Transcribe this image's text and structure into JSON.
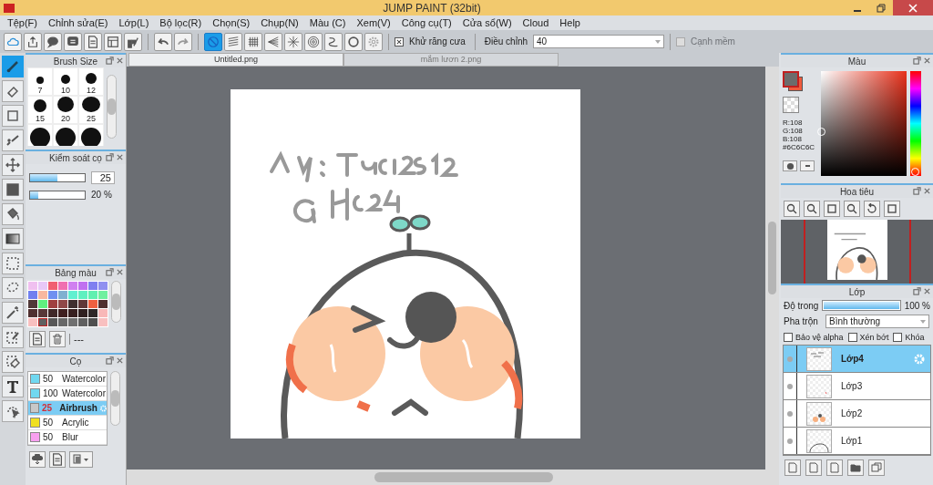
{
  "window": {
    "title": "JUMP PAINT (32bit)"
  },
  "menu": [
    "Tệp(F)",
    "Chỉnh sửa(E)",
    "Lớp(L)",
    "Bộ lọc(R)",
    "Chọn(S)",
    "Chụp(N)",
    "Màu (C)",
    "Xem(V)",
    "Công cụ(T)",
    "Cửa sổ(W)",
    "Cloud",
    "Help"
  ],
  "toolbar": {
    "groups": [
      [
        {
          "kind": "cloud",
          "selected": false
        },
        {
          "kind": "share",
          "selected": false
        },
        {
          "kind": "chat",
          "selected": false
        },
        {
          "kind": "comment",
          "selected": false
        },
        {
          "kind": "page",
          "selected": false
        },
        {
          "kind": "layout",
          "selected": false
        },
        {
          "kind": "grid-edit",
          "selected": false
        }
      ],
      [
        {
          "kind": "undo",
          "selected": false
        },
        {
          "kind": "redo",
          "selected": false
        }
      ],
      [
        {
          "kind": "no-ruler",
          "selected": true
        },
        {
          "kind": "parallel",
          "selected": false
        },
        {
          "kind": "grid",
          "selected": false
        },
        {
          "kind": "perspective",
          "selected": false
        },
        {
          "kind": "radial",
          "selected": false
        },
        {
          "kind": "concentric",
          "selected": false
        },
        {
          "kind": "curve",
          "selected": false
        },
        {
          "kind": "circle",
          "selected": false
        },
        {
          "kind": "gear",
          "selected": false
        }
      ]
    ],
    "antialias": {
      "label": "Khử răng cưa",
      "checked": true
    },
    "adjust": {
      "label": "Điều chỉnh",
      "value": "40"
    },
    "soft_edge": {
      "label": "Cạnh mềm",
      "checked": false,
      "disabled": true
    }
  },
  "tools": [
    {
      "kind": "brush",
      "selected": true
    },
    {
      "kind": "eraser",
      "selected": false
    },
    {
      "kind": "square-outline",
      "selected": false
    },
    {
      "kind": "dotted-line",
      "selected": false
    },
    {
      "kind": "move",
      "selected": false
    },
    {
      "kind": "square",
      "selected": false
    },
    {
      "kind": "bucket",
      "selected": false
    },
    {
      "kind": "gradient",
      "selected": false
    },
    {
      "kind": "rect-select",
      "selected": false
    },
    {
      "kind": "lasso",
      "selected": false
    },
    {
      "kind": "wand",
      "selected": false
    },
    {
      "kind": "select-pen",
      "selected": false
    },
    {
      "kind": "select-eraser",
      "selected": false
    },
    {
      "kind": "text",
      "selected": false
    },
    {
      "kind": "select-arrow",
      "selected": false
    }
  ],
  "brush_size": {
    "title": "Brush Size",
    "sizes": [
      "7",
      "10",
      "12",
      "15",
      "20",
      "25"
    ]
  },
  "brush_control": {
    "title": "Kiểm soát cọ",
    "sliders": [
      {
        "kind": "boxed",
        "level": 0.5,
        "value": "25"
      },
      {
        "kind": "plain",
        "level": 0.15,
        "value": "20 %"
      }
    ]
  },
  "palette": {
    "title": "Bảng màu",
    "footer": "---",
    "swatches": [
      {
        "color": "#f0c0f0",
        "selected": false
      },
      {
        "color": "#e8c8f8",
        "selected": false
      },
      {
        "color": "#f06070",
        "selected": false
      },
      {
        "color": "#f070b0",
        "selected": false
      },
      {
        "color": "#d080f0",
        "selected": false
      },
      {
        "color": "#c070f0",
        "selected": false
      },
      {
        "color": "#8080f0",
        "selected": false
      },
      {
        "color": "#9090f0",
        "selected": false
      },
      {
        "color": "#7080f0",
        "selected": false
      },
      {
        "color": "#f8b8a0",
        "selected": false
      },
      {
        "color": "#7090f0",
        "selected": false
      },
      {
        "color": "#80b0d0",
        "selected": false
      },
      {
        "color": "#60f0d0",
        "selected": false
      },
      {
        "color": "#60f0c0",
        "selected": false
      },
      {
        "color": "#60f0b0",
        "selected": false
      },
      {
        "color": "#70f0a0",
        "selected": false
      },
      {
        "color": "#503838",
        "selected": false
      },
      {
        "color": "#60f080",
        "selected": false
      },
      {
        "color": "#a04040",
        "selected": false
      },
      {
        "color": "#904848",
        "selected": false
      },
      {
        "color": "#403030",
        "selected": false
      },
      {
        "color": "#603838",
        "selected": false
      },
      {
        "color": "#f06040",
        "selected": false
      },
      {
        "color": "#503030",
        "selected": false
      },
      {
        "color": "#503030",
        "selected": false
      },
      {
        "color": "#583838",
        "selected": false
      },
      {
        "color": "#402828",
        "selected": false
      },
      {
        "color": "#402020",
        "selected": false
      },
      {
        "color": "#382020",
        "selected": false
      },
      {
        "color": "#302020",
        "selected": false
      },
      {
        "color": "#302828",
        "selected": false
      },
      {
        "color": "#f8b8b8",
        "selected": false
      },
      {
        "color": "#f8c0c0",
        "selected": false
      },
      {
        "color": "#606060",
        "selected": true
      },
      {
        "color": "#585858",
        "selected": false
      },
      {
        "color": "#686868",
        "selected": false
      },
      {
        "color": "#707070",
        "selected": false
      },
      {
        "color": "#606060",
        "selected": false
      },
      {
        "color": "#505050",
        "selected": false
      },
      {
        "color": "#f8c0c0",
        "selected": false
      }
    ]
  },
  "brushes": {
    "title": "Cọ",
    "items": [
      {
        "color": "#70d8f0",
        "size": "50",
        "name": "Watercolor",
        "selected": false
      },
      {
        "color": "#70d8f0",
        "size": "100",
        "name": "Watercolor",
        "selected": false
      },
      {
        "color": "#c8c8c8",
        "size": "25",
        "name": "Airbrush",
        "selected": true
      },
      {
        "color": "#f0e020",
        "size": "50",
        "name": "Acrylic",
        "selected": false
      },
      {
        "color": "#f8a0f0",
        "size": "50",
        "name": "Blur",
        "selected": false
      }
    ]
  },
  "tabs": [
    {
      "label": "Untitled.png",
      "selected": true
    },
    {
      "label": "mắm lươn 2.png",
      "selected": false
    }
  ],
  "color_panel": {
    "title": "Màu",
    "swatches": [
      {
        "color": "#6c6c6c"
      },
      {
        "color": "#f05a3c"
      }
    ],
    "hue": {
      "level": 0
    },
    "readout": [
      "R:108",
      "G:108",
      "B:108",
      "#6C6C6C"
    ]
  },
  "navigator": {
    "title": "Hoa tiêu"
  },
  "layers": {
    "title": "Lớp",
    "opacity": {
      "label": "Độ trong",
      "level": 1,
      "value": "100 %"
    },
    "blend": {
      "label": "Pha trộn",
      "value": "Bình thường"
    },
    "options": [
      {
        "label": "Bảo vệ alpha",
        "checked": false
      },
      {
        "label": "Xén bớt",
        "checked": false
      },
      {
        "label": "Khóa",
        "checked": false
      }
    ],
    "items": [
      {
        "name": "Lớp4",
        "kind": "sketch",
        "selected": true
      },
      {
        "name": "Lớp3",
        "kind": "empty",
        "selected": false
      },
      {
        "name": "Lớp2",
        "kind": "cheeks",
        "selected": false
      },
      {
        "name": "Lớp1",
        "kind": "outline",
        "selected": false
      }
    ]
  }
}
